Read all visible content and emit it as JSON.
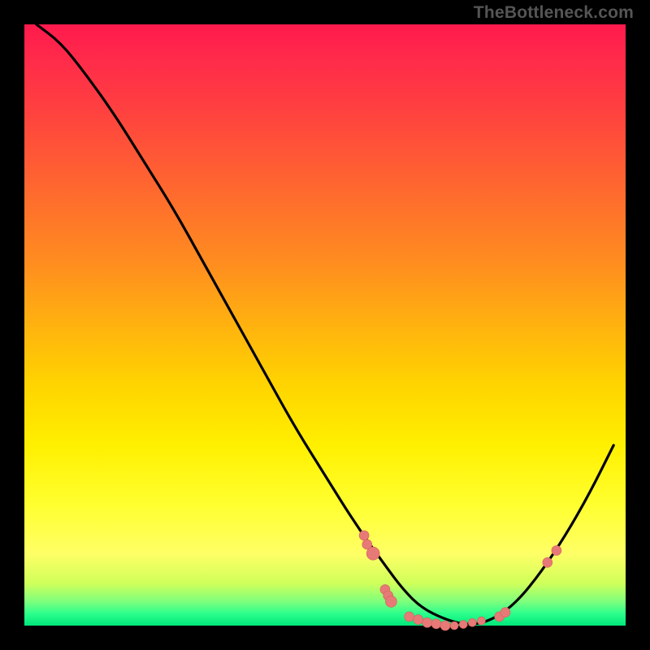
{
  "watermark": "TheBottleneck.com",
  "chart_data": {
    "type": "line",
    "title": "",
    "xlabel": "",
    "ylabel": "",
    "xlim": [
      0,
      100
    ],
    "ylim": [
      0,
      100
    ],
    "series": [
      {
        "name": "curve",
        "x": [
          2,
          6,
          10,
          15,
          20,
          25,
          30,
          35,
          40,
          45,
          50,
          55,
          60,
          63,
          66,
          70,
          74,
          78,
          82,
          86,
          90,
          94,
          98
        ],
        "y": [
          100,
          97,
          92,
          85,
          77,
          69,
          60,
          51,
          42,
          33,
          25,
          17,
          10,
          6,
          3,
          1,
          0,
          1,
          4,
          9,
          15,
          22,
          30
        ]
      }
    ],
    "markers": [
      {
        "x": 56.5,
        "y": 15.0,
        "r": 6
      },
      {
        "x": 57.0,
        "y": 13.5,
        "r": 6
      },
      {
        "x": 58.0,
        "y": 12.0,
        "r": 8
      },
      {
        "x": 60.0,
        "y": 6.0,
        "r": 6
      },
      {
        "x": 60.5,
        "y": 5.0,
        "r": 6
      },
      {
        "x": 61.0,
        "y": 4.0,
        "r": 7
      },
      {
        "x": 64.0,
        "y": 1.5,
        "r": 6
      },
      {
        "x": 65.5,
        "y": 1.0,
        "r": 6
      },
      {
        "x": 67.0,
        "y": 0.5,
        "r": 6
      },
      {
        "x": 68.5,
        "y": 0.3,
        "r": 6
      },
      {
        "x": 70.0,
        "y": 0.0,
        "r": 6
      },
      {
        "x": 71.5,
        "y": 0.0,
        "r": 5
      },
      {
        "x": 73.0,
        "y": 0.2,
        "r": 5
      },
      {
        "x": 74.5,
        "y": 0.5,
        "r": 5
      },
      {
        "x": 76.0,
        "y": 0.8,
        "r": 5
      },
      {
        "x": 79.0,
        "y": 1.5,
        "r": 6
      },
      {
        "x": 80.0,
        "y": 2.2,
        "r": 6
      },
      {
        "x": 87.0,
        "y": 10.5,
        "r": 6
      },
      {
        "x": 88.5,
        "y": 12.5,
        "r": 6
      }
    ],
    "colors": {
      "curve": "#000000",
      "marker_fill": "#e77a77",
      "marker_stroke": "#d25f5c"
    }
  }
}
